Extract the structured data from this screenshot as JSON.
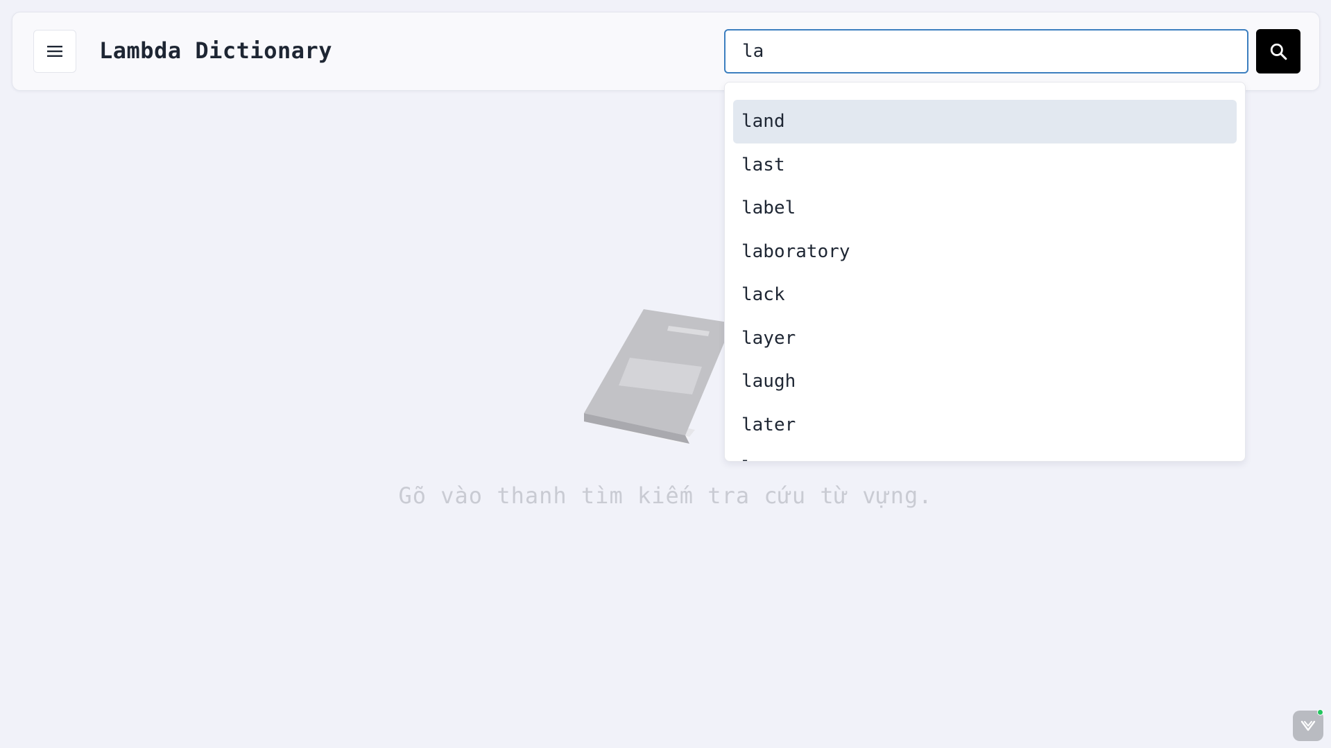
{
  "app": {
    "title": "Lambda Dictionary"
  },
  "header": {
    "menu_icon": "hamburger-menu-icon",
    "search": {
      "value": "la",
      "placeholder": ""
    },
    "search_icon": "search-icon"
  },
  "suggestions": {
    "items": [
      "land",
      "last",
      "label",
      "laboratory",
      "lack",
      "layer",
      "laugh",
      "later",
      "la"
    ],
    "highlighted_index": 0
  },
  "empty_state": {
    "illustration": "book-icon",
    "hint": "Gõ vào thanh tìm kiếm tra cứu từ vựng."
  },
  "widget": {
    "icon": "chat-widget-icon",
    "status": "online"
  },
  "colors": {
    "background": "#f1f2f9",
    "accent_border": "#3b7ebf",
    "search_button": "#000000",
    "highlight": "#e2e8f0",
    "status_online": "#22c55e"
  }
}
